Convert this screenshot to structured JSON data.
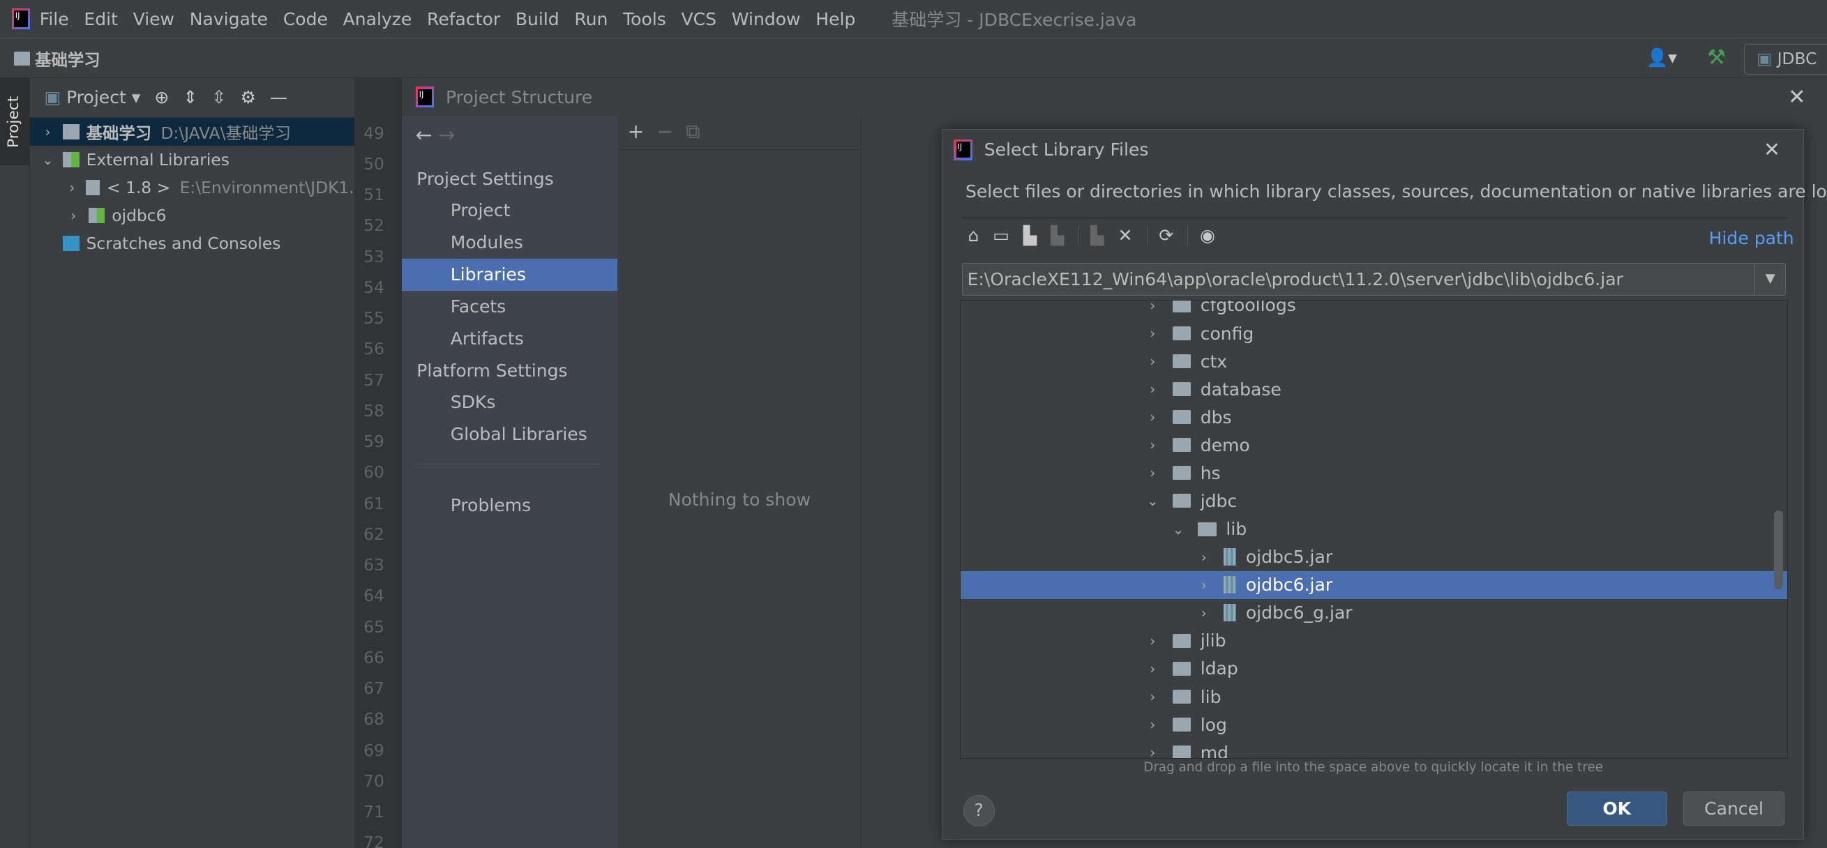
{
  "menubar": {
    "items": [
      "File",
      "Edit",
      "View",
      "Navigate",
      "Code",
      "Analyze",
      "Refactor",
      "Build",
      "Run",
      "Tools",
      "VCS",
      "Window",
      "Help"
    ],
    "title": "基础学习 - JDBCExecrise.java"
  },
  "toolbar": {
    "breadcrumb": "基础学习",
    "run_config": "JDBC"
  },
  "side_strip": {
    "tab": "Project"
  },
  "project_panel": {
    "view": "Project",
    "tree": [
      {
        "label": "基础学习",
        "path": "D:\\JAVA\\基础学习",
        "selected": true
      },
      {
        "label": "External Libraries"
      },
      {
        "label": "< 1.8 >",
        "path": "E:\\Environment\\JDK1."
      },
      {
        "label": "ojdbc6"
      },
      {
        "label": "Scratches and Consoles"
      }
    ]
  },
  "gutter": {
    "lines": [
      "49",
      "50",
      "51",
      "52",
      "53",
      "54",
      "55",
      "56",
      "57",
      "58",
      "59",
      "60",
      "61",
      "62",
      "63",
      "64",
      "65",
      "66",
      "67",
      "68",
      "69",
      "70",
      "71",
      "72"
    ]
  },
  "project_structure": {
    "title": "Project Structure",
    "project_settings": "Project Settings",
    "ps_items": [
      "Project",
      "Modules",
      "Libraries",
      "Facets",
      "Artifacts"
    ],
    "platform_settings": "Platform Settings",
    "pl_items": [
      "SDKs",
      "Global Libraries"
    ],
    "problems": "Problems",
    "selected": "Libraries",
    "empty": "Nothing to show"
  },
  "select_library": {
    "title": "Select Library Files",
    "description": "Select files or directories in which library classes, sources, documentation or native libraries are located",
    "hide_path": "Hide path",
    "path": "E:\\OracleXE112_Win64\\app\\oracle\\product\\11.2.0\\server\\jdbc\\lib\\ojdbc6.jar",
    "tree": [
      {
        "label": "cfgtoollogs",
        "depth": 0,
        "type": "folder",
        "exp": false
      },
      {
        "label": "config",
        "depth": 0,
        "type": "folder",
        "exp": false
      },
      {
        "label": "ctx",
        "depth": 0,
        "type": "folder",
        "exp": false
      },
      {
        "label": "database",
        "depth": 0,
        "type": "folder",
        "exp": false
      },
      {
        "label": "dbs",
        "depth": 0,
        "type": "folder",
        "exp": false
      },
      {
        "label": "demo",
        "depth": 0,
        "type": "folder",
        "exp": false
      },
      {
        "label": "hs",
        "depth": 0,
        "type": "folder",
        "exp": false
      },
      {
        "label": "jdbc",
        "depth": 0,
        "type": "folder",
        "exp": true
      },
      {
        "label": "lib",
        "depth": 1,
        "type": "folder",
        "exp": true
      },
      {
        "label": "ojdbc5.jar",
        "depth": 2,
        "type": "jar",
        "exp": false
      },
      {
        "label": "ojdbc6.jar",
        "depth": 2,
        "type": "jar",
        "exp": false,
        "selected": true
      },
      {
        "label": "ojdbc6_g.jar",
        "depth": 2,
        "type": "jar",
        "exp": false
      },
      {
        "label": "jlib",
        "depth": 0,
        "type": "folder",
        "exp": false
      },
      {
        "label": "ldap",
        "depth": 0,
        "type": "folder",
        "exp": false
      },
      {
        "label": "lib",
        "depth": 0,
        "type": "folder",
        "exp": false
      },
      {
        "label": "log",
        "depth": 0,
        "type": "folder",
        "exp": false
      },
      {
        "label": "md",
        "depth": 0,
        "type": "folder",
        "exp": false
      }
    ],
    "hint": "Drag and drop a file into the space above to quickly locate it in the tree",
    "ok": "OK",
    "cancel": "Cancel",
    "help": "?"
  },
  "colors": {
    "selection": "#4b6eaf",
    "link": "#589df6",
    "background": "#3c3f41"
  }
}
